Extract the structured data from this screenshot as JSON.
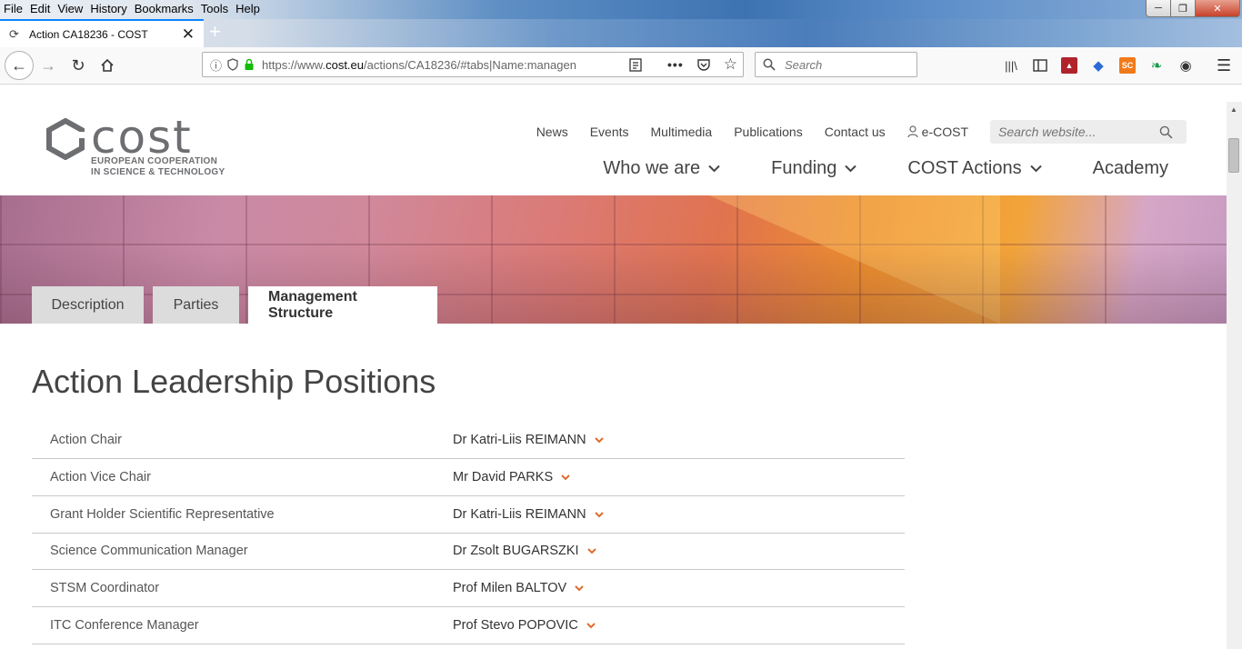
{
  "window": {
    "menu": [
      "File",
      "Edit",
      "View",
      "History",
      "Bookmarks",
      "Tools",
      "Help"
    ],
    "controls": {
      "minimize": "─",
      "maximize": "❐",
      "close": "✕"
    }
  },
  "browser": {
    "tab_title": "Action CA18236 - COST",
    "tab_close": "✕",
    "new_tab": "+",
    "url_prefix": "https://www.",
    "url_domain": "cost.eu",
    "url_rest": "/actions/CA18236/#tabs|Name:managen",
    "search_placeholder": "Search",
    "icons": {
      "back": "back-arrow-icon",
      "forward": "forward-arrow-icon",
      "reload": "reload-icon",
      "home": "home-icon",
      "info": "info-icon",
      "tracking": "shield-icon",
      "lock": "lock-icon",
      "reader": "reader-view-icon",
      "more": "more-icon",
      "pocket": "pocket-icon",
      "bookmark": "star-icon"
    },
    "toolbar_extension_labels": {
      "sc": "SC"
    }
  },
  "site": {
    "logo": {
      "wordmark": "cost",
      "tagline_line1": "EUROPEAN COOPERATION",
      "tagline_line2": "IN SCIENCE & TECHNOLOGY"
    },
    "top_nav": [
      "News",
      "Events",
      "Multimedia",
      "Publications",
      "Contact us"
    ],
    "ecost_label": "e-COST",
    "search_placeholder": "Search website...",
    "main_nav": [
      {
        "label": "Who we are",
        "dropdown": true
      },
      {
        "label": "Funding",
        "dropdown": true
      },
      {
        "label": "COST Actions",
        "dropdown": true
      },
      {
        "label": "Academy",
        "dropdown": false
      }
    ],
    "tabs": [
      {
        "label": "Description",
        "active": false
      },
      {
        "label": "Parties",
        "active": false
      },
      {
        "label": "Management Structure",
        "active": true
      }
    ],
    "heading": "Action Leadership Positions",
    "positions": [
      {
        "role": "Action Chair",
        "person": "Dr Katri-Liis REIMANN"
      },
      {
        "role": "Action Vice Chair",
        "person": "Mr David PARKS"
      },
      {
        "role": "Grant Holder Scientific Representative",
        "person": "Dr Katri-Liis REIMANN"
      },
      {
        "role": "Science Communication Manager",
        "person": "Dr Zsolt BUGARSZKI"
      },
      {
        "role": "STSM Coordinator",
        "person": "Prof Milen BALTOV"
      },
      {
        "role": "ITC Conference Manager",
        "person": "Prof Stevo POPOVIC"
      }
    ]
  },
  "colors": {
    "accent_orange": "#e06b2c",
    "firefox_blue": "#0a84ff",
    "lock_green": "#12bc00"
  }
}
